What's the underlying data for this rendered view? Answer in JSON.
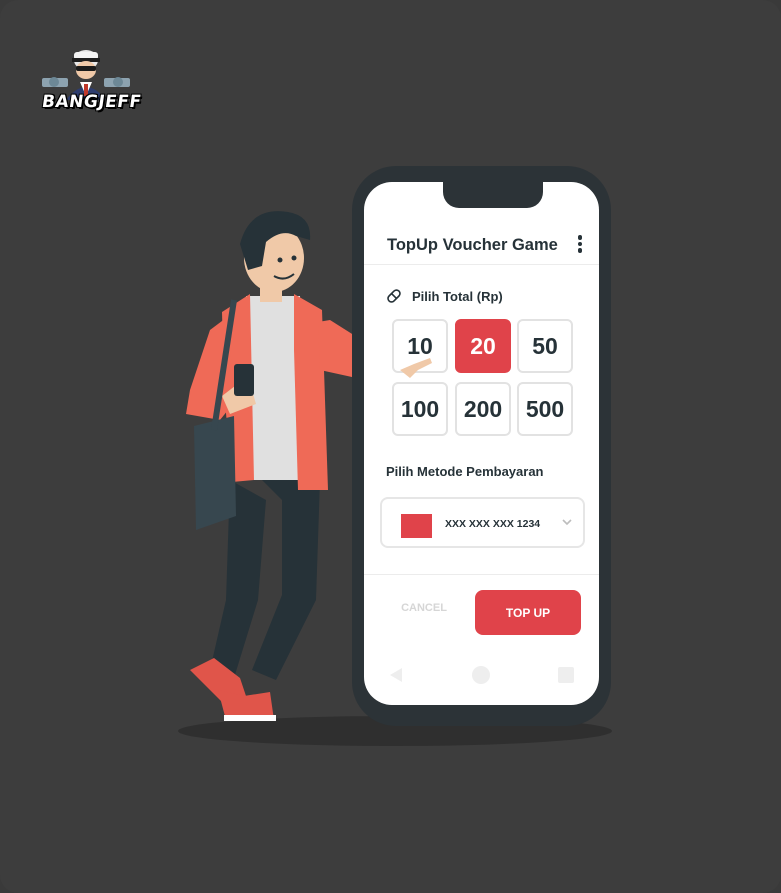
{
  "brand": {
    "logo_text": "BANGJEFF"
  },
  "app": {
    "title": "TopUp Voucher Game",
    "menu_icon": "kebab-menu-icon"
  },
  "amount_section": {
    "label": "Pilih Total (Rp)",
    "icon": "pill-icon",
    "options": [
      "10",
      "20",
      "50",
      "100",
      "200",
      "500"
    ],
    "selected": "20"
  },
  "payment_section": {
    "label": "Pilih Metode Pembayaran",
    "card_number": "XXX XXX XXX 1234",
    "dropdown_icon": "chevron-down-icon"
  },
  "actions": {
    "cancel_label": "CANCEL",
    "topup_label": "TOP UP"
  },
  "nav": {
    "back_icon": "back-triangle-icon",
    "home_icon": "home-circle-icon",
    "recent_icon": "recent-square-icon"
  },
  "colors": {
    "accent": "#e0434a",
    "background": "#3d3d3d",
    "phone_frame": "#2c3337",
    "text_dark": "#263238"
  }
}
